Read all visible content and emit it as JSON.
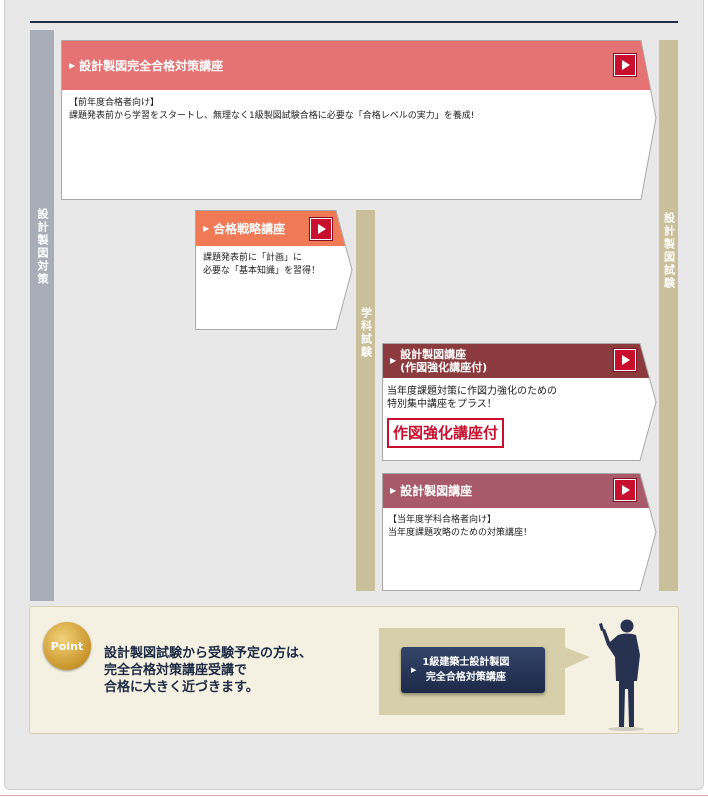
{
  "side_labels": {
    "left": "設計製図対策",
    "middle": "学科試験",
    "right": "設計製図試験"
  },
  "courses": {
    "complete": {
      "title": "設計製図完全合格対策講座",
      "body_line1": "【前年度合格者向け】",
      "body_line2": "課題発表前から学習をスタートし、無理なく1級製図試験合格に必要な「合格レベルの実力」を養成!"
    },
    "strategy": {
      "title": "合格戦略講座",
      "body_line1": "課題発表前に「計画」に",
      "body_line2": "必要な「基本知識」を習得！"
    },
    "drafting_plus": {
      "title_line1": "設計製図講座",
      "title_line2": "(作図強化講座付)",
      "body_line1": "当年度課題対策に作図力強化のための",
      "body_line2": "特別集中講座をプラス！",
      "stamp": "作図強化講座付"
    },
    "drafting": {
      "title": "設計製図講座",
      "body_line1": "【当年度学科合格者向け】",
      "body_line2": "当年度課題攻略のための対策講座！"
    }
  },
  "point": {
    "badge": "Point",
    "line1": "設計製図試験から受験予定の方は、",
    "line2": "完全合格対策講座受講で",
    "line3": "合格に大きく近づきます。",
    "button_line1": "1級建築士設計製図",
    "button_line2": "完全合格対策講座"
  },
  "icons": {
    "play": "play-icon",
    "arrow": "triangle-right-icon",
    "figure": "businessman-silhouette-icon"
  },
  "colors": {
    "salmon": "#e57373",
    "orange": "#f07a56",
    "maroon": "#8b3a3e",
    "rose": "#a85a6a",
    "navy": "#1c2a48",
    "tan": "#c9bf9a",
    "red": "#c8102e"
  }
}
